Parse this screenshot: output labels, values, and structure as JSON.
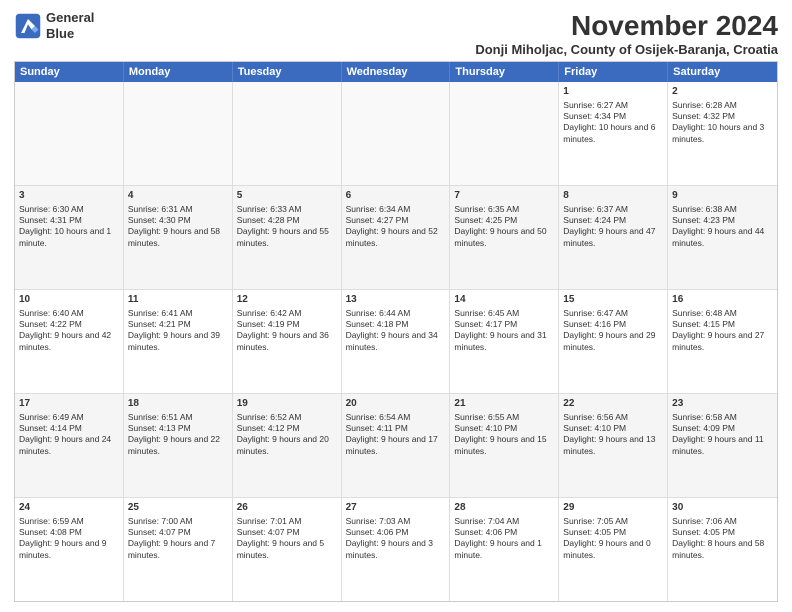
{
  "logo": {
    "line1": "General",
    "line2": "Blue"
  },
  "title": "November 2024",
  "subtitle": "Donji Miholjac, County of Osijek-Baranja, Croatia",
  "days_of_week": [
    "Sunday",
    "Monday",
    "Tuesday",
    "Wednesday",
    "Thursday",
    "Friday",
    "Saturday"
  ],
  "rows": [
    [
      {
        "day": "",
        "info": "",
        "empty": true
      },
      {
        "day": "",
        "info": "",
        "empty": true
      },
      {
        "day": "",
        "info": "",
        "empty": true
      },
      {
        "day": "",
        "info": "",
        "empty": true
      },
      {
        "day": "",
        "info": "",
        "empty": true
      },
      {
        "day": "1",
        "info": "Sunrise: 6:27 AM\nSunset: 4:34 PM\nDaylight: 10 hours and 6 minutes."
      },
      {
        "day": "2",
        "info": "Sunrise: 6:28 AM\nSunset: 4:32 PM\nDaylight: 10 hours and 3 minutes."
      }
    ],
    [
      {
        "day": "3",
        "info": "Sunrise: 6:30 AM\nSunset: 4:31 PM\nDaylight: 10 hours and 1 minute."
      },
      {
        "day": "4",
        "info": "Sunrise: 6:31 AM\nSunset: 4:30 PM\nDaylight: 9 hours and 58 minutes."
      },
      {
        "day": "5",
        "info": "Sunrise: 6:33 AM\nSunset: 4:28 PM\nDaylight: 9 hours and 55 minutes."
      },
      {
        "day": "6",
        "info": "Sunrise: 6:34 AM\nSunset: 4:27 PM\nDaylight: 9 hours and 52 minutes."
      },
      {
        "day": "7",
        "info": "Sunrise: 6:35 AM\nSunset: 4:25 PM\nDaylight: 9 hours and 50 minutes."
      },
      {
        "day": "8",
        "info": "Sunrise: 6:37 AM\nSunset: 4:24 PM\nDaylight: 9 hours and 47 minutes."
      },
      {
        "day": "9",
        "info": "Sunrise: 6:38 AM\nSunset: 4:23 PM\nDaylight: 9 hours and 44 minutes."
      }
    ],
    [
      {
        "day": "10",
        "info": "Sunrise: 6:40 AM\nSunset: 4:22 PM\nDaylight: 9 hours and 42 minutes."
      },
      {
        "day": "11",
        "info": "Sunrise: 6:41 AM\nSunset: 4:21 PM\nDaylight: 9 hours and 39 minutes."
      },
      {
        "day": "12",
        "info": "Sunrise: 6:42 AM\nSunset: 4:19 PM\nDaylight: 9 hours and 36 minutes."
      },
      {
        "day": "13",
        "info": "Sunrise: 6:44 AM\nSunset: 4:18 PM\nDaylight: 9 hours and 34 minutes."
      },
      {
        "day": "14",
        "info": "Sunrise: 6:45 AM\nSunset: 4:17 PM\nDaylight: 9 hours and 31 minutes."
      },
      {
        "day": "15",
        "info": "Sunrise: 6:47 AM\nSunset: 4:16 PM\nDaylight: 9 hours and 29 minutes."
      },
      {
        "day": "16",
        "info": "Sunrise: 6:48 AM\nSunset: 4:15 PM\nDaylight: 9 hours and 27 minutes."
      }
    ],
    [
      {
        "day": "17",
        "info": "Sunrise: 6:49 AM\nSunset: 4:14 PM\nDaylight: 9 hours and 24 minutes."
      },
      {
        "day": "18",
        "info": "Sunrise: 6:51 AM\nSunset: 4:13 PM\nDaylight: 9 hours and 22 minutes."
      },
      {
        "day": "19",
        "info": "Sunrise: 6:52 AM\nSunset: 4:12 PM\nDaylight: 9 hours and 20 minutes."
      },
      {
        "day": "20",
        "info": "Sunrise: 6:54 AM\nSunset: 4:11 PM\nDaylight: 9 hours and 17 minutes."
      },
      {
        "day": "21",
        "info": "Sunrise: 6:55 AM\nSunset: 4:10 PM\nDaylight: 9 hours and 15 minutes."
      },
      {
        "day": "22",
        "info": "Sunrise: 6:56 AM\nSunset: 4:10 PM\nDaylight: 9 hours and 13 minutes."
      },
      {
        "day": "23",
        "info": "Sunrise: 6:58 AM\nSunset: 4:09 PM\nDaylight: 9 hours and 11 minutes."
      }
    ],
    [
      {
        "day": "24",
        "info": "Sunrise: 6:59 AM\nSunset: 4:08 PM\nDaylight: 9 hours and 9 minutes."
      },
      {
        "day": "25",
        "info": "Sunrise: 7:00 AM\nSunset: 4:07 PM\nDaylight: 9 hours and 7 minutes."
      },
      {
        "day": "26",
        "info": "Sunrise: 7:01 AM\nSunset: 4:07 PM\nDaylight: 9 hours and 5 minutes."
      },
      {
        "day": "27",
        "info": "Sunrise: 7:03 AM\nSunset: 4:06 PM\nDaylight: 9 hours and 3 minutes."
      },
      {
        "day": "28",
        "info": "Sunrise: 7:04 AM\nSunset: 4:06 PM\nDaylight: 9 hours and 1 minute."
      },
      {
        "day": "29",
        "info": "Sunrise: 7:05 AM\nSunset: 4:05 PM\nDaylight: 9 hours and 0 minutes."
      },
      {
        "day": "30",
        "info": "Sunrise: 7:06 AM\nSunset: 4:05 PM\nDaylight: 8 hours and 58 minutes."
      }
    ]
  ]
}
